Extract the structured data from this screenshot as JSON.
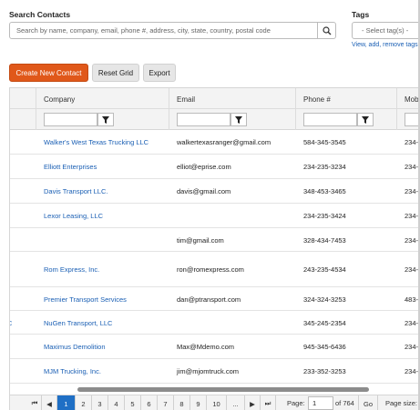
{
  "search": {
    "label": "Search Contacts",
    "placeholder": "Search by name, company, email, phone #, address, city, state, country, postal code"
  },
  "tags": {
    "label": "Tags",
    "placeholder": "- Select tag(s) -",
    "link": "View, add, remove tags"
  },
  "toolbar": {
    "create_label": "Create New Contact",
    "reset_label": "Reset Grid",
    "export_label": "Export"
  },
  "grid": {
    "columns": [
      "Company",
      "Email",
      "Phone #",
      "Mob"
    ],
    "rows": [
      {
        "prefix": "",
        "company": "Walker's West Texas Trucking LLC",
        "email": "walkertexasranger@gmail.com",
        "phone": "584-345-3545",
        "mobile": "234-"
      },
      {
        "prefix": "",
        "company": "Elliott Enterprises",
        "email": "elliot@eprise.com",
        "phone": "234-235-3234",
        "mobile": "234-"
      },
      {
        "prefix": "",
        "company": "Davis Transport LLC.",
        "email": "davis@gmail.com",
        "phone": "348-453-3465",
        "mobile": "234-"
      },
      {
        "prefix": "",
        "company": "Lexor Leasing, LLC",
        "email": "",
        "phone": "234-235-3424",
        "mobile": "234-"
      },
      {
        "prefix": "",
        "company": "",
        "email": "tim@gmail.com",
        "phone": "328-434-7453",
        "mobile": "234-"
      },
      {
        "prefix": "",
        "company": "Rom Express, Inc.",
        "email": "ron@romexpress.com",
        "phone": "243-235-4534",
        "mobile": "234-"
      },
      {
        "prefix": "",
        "company": "Premier Transport Services",
        "email": "dan@ptransport.com",
        "phone": "324-324-3253",
        "mobile": "483-"
      },
      {
        "prefix": "C",
        "company": "NuGen Transport, LLC",
        "email": "",
        "phone": "345-245-2354",
        "mobile": "234-"
      },
      {
        "prefix": "",
        "company": "Maximus Demolition",
        "email": "Max@Mdemo.com",
        "phone": "945-345-6436",
        "mobile": "234-"
      },
      {
        "prefix": "",
        "company": "MJM Trucking, Inc.",
        "email": "jim@mjomtruck.com",
        "phone": "233-352-3253",
        "mobile": "234-"
      }
    ]
  },
  "pager": {
    "first": "⏮",
    "prev": "◀",
    "pages": [
      "1",
      "2",
      "3",
      "4",
      "5",
      "6",
      "7",
      "8",
      "9",
      "10",
      "..."
    ],
    "next": "▶",
    "last": "⏭",
    "page_label": "Page:",
    "page_value": "1",
    "of_label": "of 764",
    "go_label": "Go",
    "size_label": "Page size:"
  },
  "icons": {
    "search": "search-icon",
    "filter": "filter-icon"
  },
  "colors": {
    "primary_button": "#e0581a",
    "link": "#1a5fb4",
    "active_page": "#1f6fc5"
  }
}
